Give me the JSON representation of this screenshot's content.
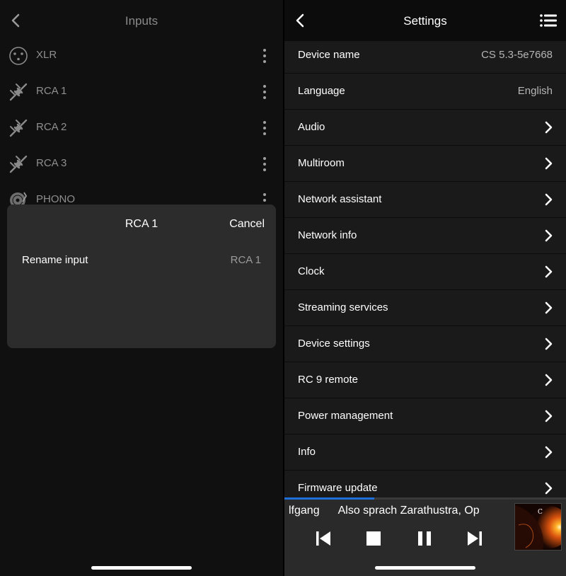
{
  "left": {
    "title": "Inputs",
    "inputs": [
      {
        "label": "XLR",
        "icon": "xlr-connector-icon"
      },
      {
        "label": "RCA 1",
        "icon": "rca-plug-icon"
      },
      {
        "label": "RCA 2",
        "icon": "rca-plug-icon"
      },
      {
        "label": "RCA 3",
        "icon": "rca-plug-icon"
      },
      {
        "label": "PHONO",
        "icon": "turntable-icon"
      }
    ],
    "sheet": {
      "title": "RCA 1",
      "cancel": "Cancel",
      "row_label": "Rename input",
      "row_value": "RCA 1"
    }
  },
  "right": {
    "title": "Settings",
    "settings": [
      {
        "label": "Device name",
        "value": "CS 5.3-5e7668"
      },
      {
        "label": "Language",
        "value": "English"
      },
      {
        "label": "Audio"
      },
      {
        "label": "Multiroom"
      },
      {
        "label": "Network assistant"
      },
      {
        "label": "Network info"
      },
      {
        "label": "Clock"
      },
      {
        "label": "Streaming services"
      },
      {
        "label": "Device settings"
      },
      {
        "label": "RC 9 remote"
      },
      {
        "label": "Power management"
      },
      {
        "label": "Info"
      },
      {
        "label": "Firmware update"
      }
    ],
    "player": {
      "artist_fragment": "lfgang",
      "track_fragment": "Also sprach Zarathustra, Op",
      "progress": 0.32
    }
  },
  "colors": {
    "accent": "#1e6fd9",
    "row_bg": "#1a1a1a",
    "sheet_bg": "#2c2c2c"
  }
}
